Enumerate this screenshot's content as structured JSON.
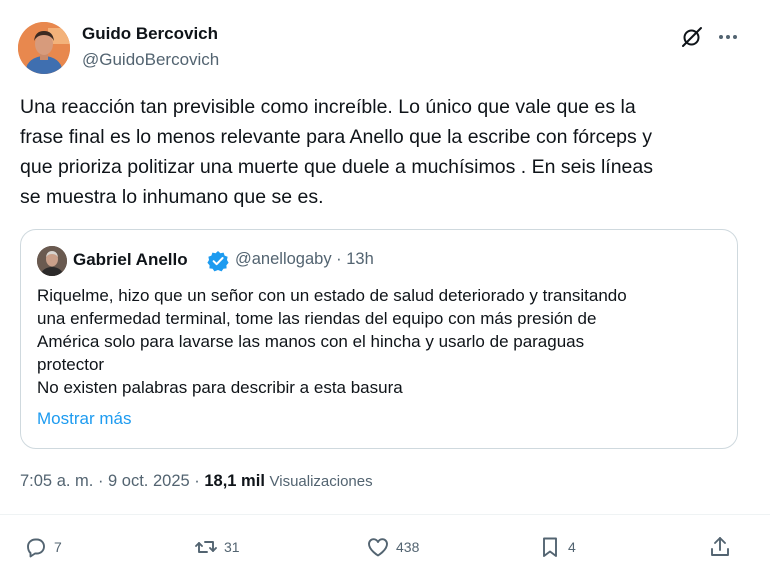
{
  "author": {
    "name": "Guido Bercovich",
    "handle": "@GuidoBercovich"
  },
  "header_icons": [
    "grok-icon",
    "more-options-icon"
  ],
  "tweet": {
    "text": "Una reacción tan previsible como increíble. Lo único que vale que es la\nfrase final es lo menos relevante para Anello que la escribe con fórceps y\nque prioriza politizar una muerte que duele a muchísimos . En seis líneas\nse muestra lo inhumano que se es."
  },
  "quote": {
    "name": "Gabriel Anello",
    "verified": true,
    "handle_time": "@anellogaby · 13h",
    "text": "Riquelme, hizo que un señor con un estado de salud deteriorado y transitando\nuna enfermedad terminal, tome las riendas del equipo con más presión de\nAmérica solo para lavarse las manos con el hincha y usarlo de paraguas\nprotector\nNo existen palabras para describir a esta basura",
    "show_more": "Mostrar más"
  },
  "meta": {
    "timestamp": "7:05 a. m. · 9 oct. 2025 · ",
    "views_count": "18,1 mil",
    "views_label": "Visualizaciones"
  },
  "actions": {
    "replies": "7",
    "retweets": "31",
    "likes": "438",
    "bookmarks": "4"
  },
  "colors": {
    "text": "#0f1419",
    "secondary": "#536471",
    "link": "#1d9bf0",
    "border": "#cfd9de"
  }
}
